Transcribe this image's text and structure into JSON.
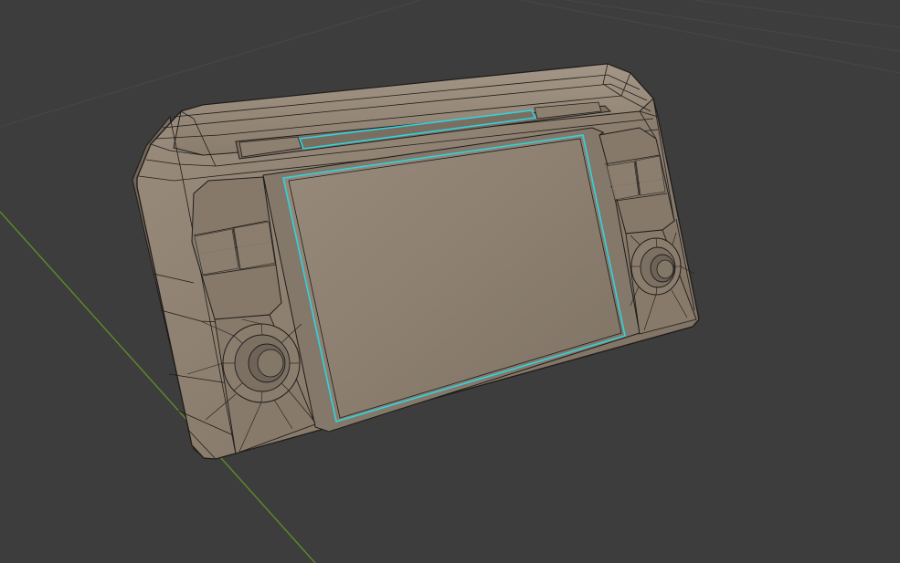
{
  "viewport": {
    "background_color": "#3d3d3d",
    "grid_line_color": "#474747",
    "x_axis_color": "#5f8a2a",
    "mesh_face_color": "#8e8070",
    "mesh_edge_color": "#1e1c1a",
    "selected_edge_color": "#2fd3e0"
  },
  "object": {
    "display_mode": "wireframe-overlay",
    "has_selected_edges": true
  }
}
